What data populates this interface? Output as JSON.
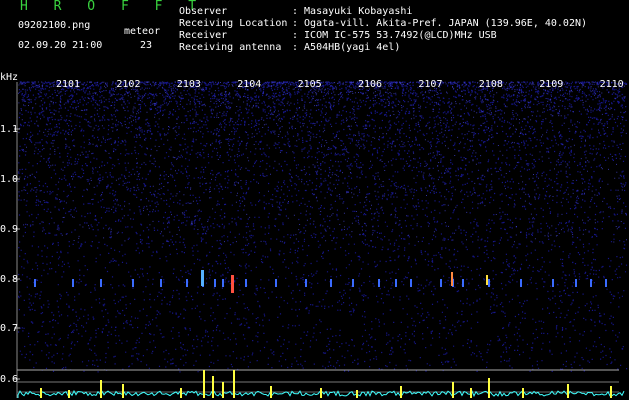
{
  "header": {
    "title": "H R O F F T",
    "filename": "09202100.png",
    "datetime": "02.09.20 21:00",
    "meteor_label": "meteor",
    "meteor_count": "23",
    "observer_label": "Observer",
    "observer_value": ": Masayuki Kobayashi",
    "location_label": "Receiving Location",
    "location_value": ": Ogata-vill. Akita-Pref. JAPAN (139.96E, 40.02N)",
    "receiver_label": "Receiver",
    "receiver_value": ": ICOM IC-575 53.7492(@LCD)MHz USB",
    "antenna_label": "Receiving antenna",
    "antenna_value": ": A504HB(yagi 4el)"
  },
  "axes": {
    "y_unit": "kHz",
    "x_ticks": [
      "2101",
      "2102",
      "2103",
      "2104",
      "2105",
      "2106",
      "2107",
      "2108",
      "2109",
      "2110"
    ],
    "y_ticks": [
      "1.1",
      "1.0",
      "0.9",
      "0.8",
      "0.7",
      "0.6"
    ]
  },
  "colors": {
    "background": "#000000",
    "noise": "#1a1aa0",
    "meteor": "#ffff40",
    "echo": "#40ffff",
    "title": "#39d33f"
  }
}
